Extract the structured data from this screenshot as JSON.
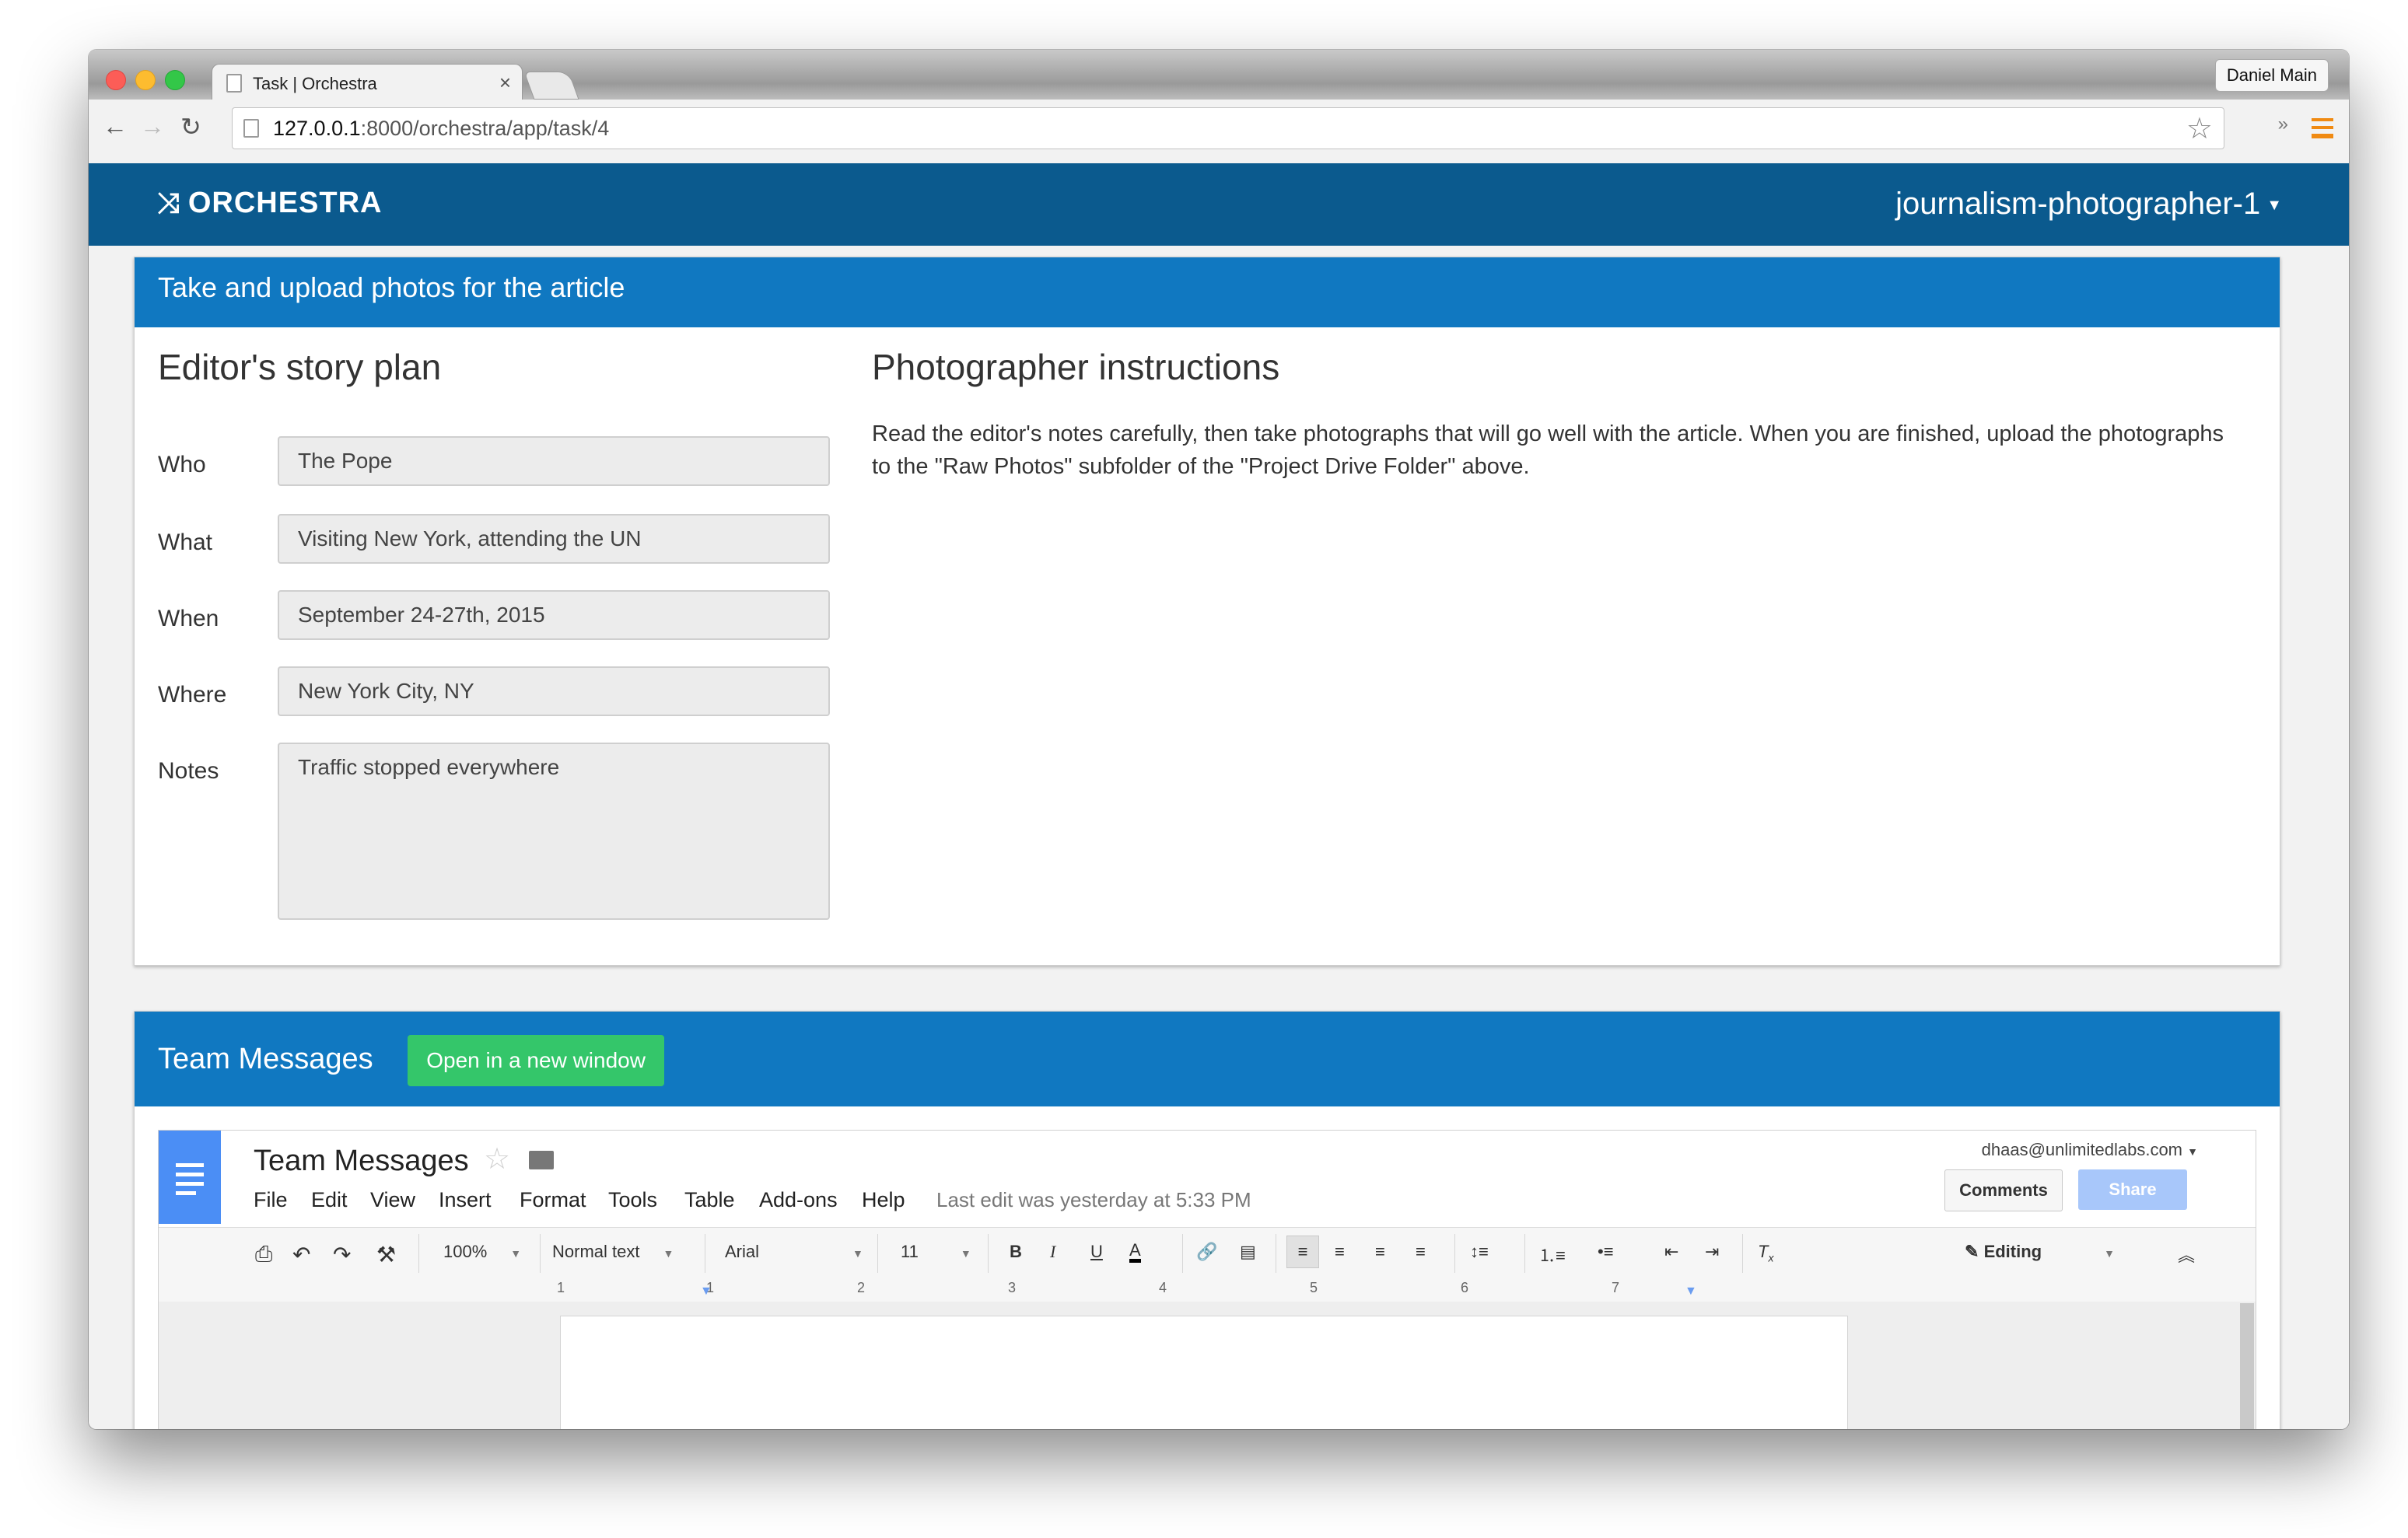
{
  "browser": {
    "tab_title": "Task | Orchestra",
    "tab_close": "×",
    "profile_name": "Daniel Main",
    "url_host": "127.0.0.1",
    "url_rest": ":8000/orchestra/app/task/4",
    "ext_label": "»"
  },
  "app": {
    "brand": "ORCHESTRA",
    "user": "journalism-photographer-1"
  },
  "task_panel": {
    "title": "Take and upload photos for the article",
    "story_plan_heading": "Editor's story plan",
    "fields": [
      {
        "label": "Who",
        "value": "The Pope"
      },
      {
        "label": "What",
        "value": "Visiting New York, attending the UN"
      },
      {
        "label": "When",
        "value": "September 24-27th, 2015"
      },
      {
        "label": "Where",
        "value": "New York City, NY"
      },
      {
        "label": "Notes",
        "value": "Traffic stopped everywhere"
      }
    ],
    "instructions_heading": "Photographer instructions",
    "instructions_text": "Read the editor's notes carefully, then take photographs that will go well with the article. When you are finished, upload the photographs to the \"Raw Photos\" subfolder of the \"Project Drive Folder\" above."
  },
  "messages_panel": {
    "title": "Team Messages",
    "open_button": "Open in a new window"
  },
  "gdoc": {
    "title": "Team Messages",
    "menu": [
      "File",
      "Edit",
      "View",
      "Insert",
      "Format",
      "Tools",
      "Table",
      "Add-ons",
      "Help"
    ],
    "last_edit": "Last edit was yesterday at 5:33 PM",
    "account": "dhaas@unlimitedlabs.com",
    "comments_btn": "Comments",
    "share_btn": "Share",
    "zoom": "100%",
    "style": "Normal text",
    "font": "Arial",
    "size": "11",
    "mode": "Editing",
    "ruler": [
      "1",
      "1",
      "2",
      "3",
      "4",
      "5",
      "6",
      "7"
    ]
  }
}
